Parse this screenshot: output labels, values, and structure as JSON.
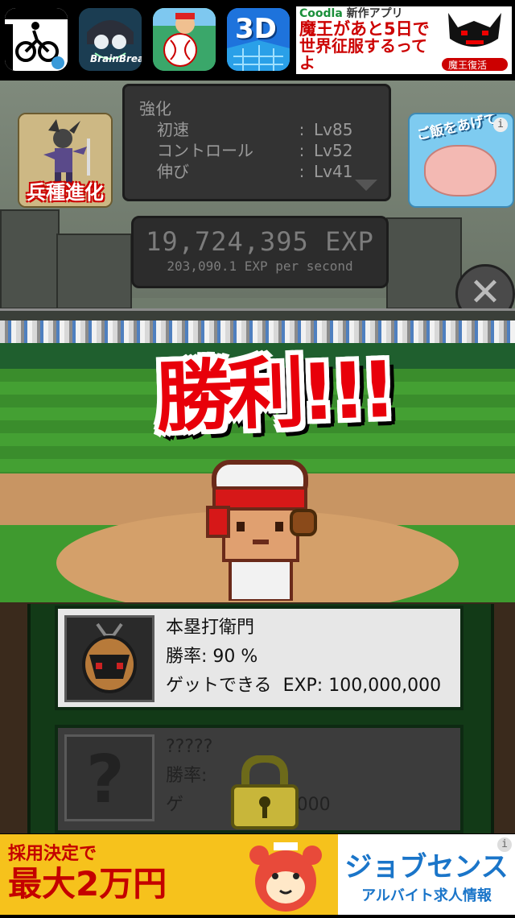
{
  "top_ads": {
    "icons": [
      {
        "label": "",
        "bg": "#ffffff"
      },
      {
        "label": "BrainBreak",
        "bg": "#123a4a"
      },
      {
        "label": "",
        "bg": "#3aa76a"
      },
      {
        "label": "3D",
        "bg": "#1e6fd9"
      }
    ],
    "banner": {
      "brand_prefix": "Coodla",
      "brand_suffix": "新作アプリ",
      "line1": "魔王があと5日で",
      "line2": "世界征服するってよ",
      "badge": "魔王復活"
    }
  },
  "stats": {
    "title": "強化",
    "rows": [
      {
        "name": "初速",
        "level": "Lv85"
      },
      {
        "name": "コントロール",
        "level": "Lv52"
      },
      {
        "name": "伸び",
        "level": "Lv41"
      }
    ]
  },
  "exp": {
    "total": "19,724,395 EXP",
    "rate": "203,090.1 EXP per second"
  },
  "evolve_button": {
    "label": "兵種進化"
  },
  "feed_button": {
    "label": "ご飯をあげて",
    "info": "i"
  },
  "close_button": {
    "label": "✕"
  },
  "victory": {
    "text": "勝利!!!"
  },
  "opponents": [
    {
      "name": "本塁打衛門",
      "win_rate_label": "勝率:",
      "win_rate": "90 %",
      "reward_label": "ゲットできる",
      "reward": "EXP: 100,000,000",
      "locked": false
    },
    {
      "name": "?????",
      "win_rate_label": "勝率:",
      "win_rate": "",
      "reward_label": "ゲ",
      "reward": "EXP: 0,000",
      "locked": true
    }
  ],
  "bottom_ad": {
    "sub": "採用決定で",
    "main": "最大2万円",
    "logo": "ジョブセンス",
    "tagline": "アルバイト求人情報",
    "info": "i"
  },
  "colors": {
    "victory_red": "#e8000a",
    "panel_green": "#123a17",
    "ad_yellow": "#f6c21c"
  }
}
